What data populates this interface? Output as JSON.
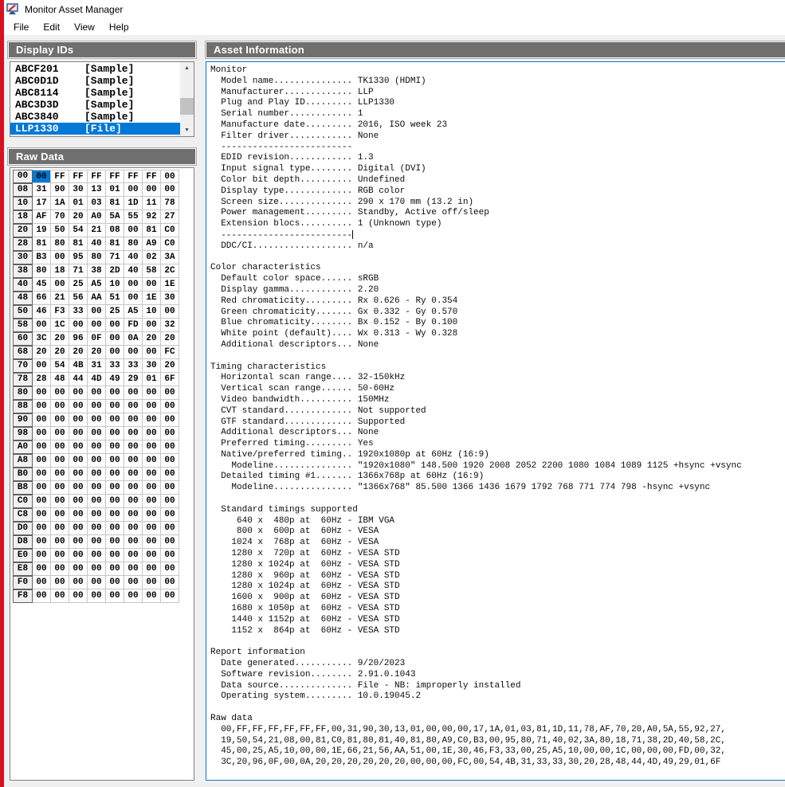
{
  "window": {
    "title": "Monitor Asset Manager",
    "menu_items": [
      "File",
      "Edit",
      "View",
      "Help"
    ]
  },
  "display_ids": {
    "header": "Display IDs",
    "items": [
      {
        "id": "ABCF201",
        "tag": "[Sample]",
        "selected": false
      },
      {
        "id": "ABC0D1D",
        "tag": "[Sample]",
        "selected": false
      },
      {
        "id": "ABC8114",
        "tag": "[Sample]",
        "selected": false
      },
      {
        "id": "ABC3D3D",
        "tag": "[Sample]",
        "selected": false
      },
      {
        "id": "ABC3840",
        "tag": "[Sample]",
        "selected": false
      },
      {
        "id": "LLP1330",
        "tag": "[File]",
        "selected": true
      }
    ],
    "scrollbar": {
      "up_icon": "▲",
      "down_icon": "▼"
    }
  },
  "raw_data": {
    "header": "Raw Data",
    "selected_cell": {
      "row": 0,
      "col": 0
    },
    "rows": [
      {
        "addr": "00",
        "bytes": [
          "00",
          "FF",
          "FF",
          "FF",
          "FF",
          "FF",
          "FF",
          "00"
        ]
      },
      {
        "addr": "08",
        "bytes": [
          "31",
          "90",
          "30",
          "13",
          "01",
          "00",
          "00",
          "00"
        ]
      },
      {
        "addr": "10",
        "bytes": [
          "17",
          "1A",
          "01",
          "03",
          "81",
          "1D",
          "11",
          "78"
        ]
      },
      {
        "addr": "18",
        "bytes": [
          "AF",
          "70",
          "20",
          "A0",
          "5A",
          "55",
          "92",
          "27"
        ]
      },
      {
        "addr": "20",
        "bytes": [
          "19",
          "50",
          "54",
          "21",
          "08",
          "00",
          "81",
          "C0"
        ]
      },
      {
        "addr": "28",
        "bytes": [
          "81",
          "80",
          "81",
          "40",
          "81",
          "80",
          "A9",
          "C0"
        ]
      },
      {
        "addr": "30",
        "bytes": [
          "B3",
          "00",
          "95",
          "80",
          "71",
          "40",
          "02",
          "3A"
        ]
      },
      {
        "addr": "38",
        "bytes": [
          "80",
          "18",
          "71",
          "38",
          "2D",
          "40",
          "58",
          "2C"
        ]
      },
      {
        "addr": "40",
        "bytes": [
          "45",
          "00",
          "25",
          "A5",
          "10",
          "00",
          "00",
          "1E"
        ]
      },
      {
        "addr": "48",
        "bytes": [
          "66",
          "21",
          "56",
          "AA",
          "51",
          "00",
          "1E",
          "30"
        ]
      },
      {
        "addr": "50",
        "bytes": [
          "46",
          "F3",
          "33",
          "00",
          "25",
          "A5",
          "10",
          "00"
        ]
      },
      {
        "addr": "58",
        "bytes": [
          "00",
          "1C",
          "00",
          "00",
          "00",
          "FD",
          "00",
          "32"
        ]
      },
      {
        "addr": "60",
        "bytes": [
          "3C",
          "20",
          "96",
          "0F",
          "00",
          "0A",
          "20",
          "20"
        ]
      },
      {
        "addr": "68",
        "bytes": [
          "20",
          "20",
          "20",
          "20",
          "00",
          "00",
          "00",
          "FC"
        ]
      },
      {
        "addr": "70",
        "bytes": [
          "00",
          "54",
          "4B",
          "31",
          "33",
          "33",
          "30",
          "20"
        ]
      },
      {
        "addr": "78",
        "bytes": [
          "28",
          "48",
          "44",
          "4D",
          "49",
          "29",
          "01",
          "6F"
        ]
      },
      {
        "addr": "80",
        "bytes": [
          "00",
          "00",
          "00",
          "00",
          "00",
          "00",
          "00",
          "00"
        ]
      },
      {
        "addr": "88",
        "bytes": [
          "00",
          "00",
          "00",
          "00",
          "00",
          "00",
          "00",
          "00"
        ]
      },
      {
        "addr": "90",
        "bytes": [
          "00",
          "00",
          "00",
          "00",
          "00",
          "00",
          "00",
          "00"
        ]
      },
      {
        "addr": "98",
        "bytes": [
          "00",
          "00",
          "00",
          "00",
          "00",
          "00",
          "00",
          "00"
        ]
      },
      {
        "addr": "A0",
        "bytes": [
          "00",
          "00",
          "00",
          "00",
          "00",
          "00",
          "00",
          "00"
        ]
      },
      {
        "addr": "A8",
        "bytes": [
          "00",
          "00",
          "00",
          "00",
          "00",
          "00",
          "00",
          "00"
        ]
      },
      {
        "addr": "B0",
        "bytes": [
          "00",
          "00",
          "00",
          "00",
          "00",
          "00",
          "00",
          "00"
        ]
      },
      {
        "addr": "B8",
        "bytes": [
          "00",
          "00",
          "00",
          "00",
          "00",
          "00",
          "00",
          "00"
        ]
      },
      {
        "addr": "C0",
        "bytes": [
          "00",
          "00",
          "00",
          "00",
          "00",
          "00",
          "00",
          "00"
        ]
      },
      {
        "addr": "C8",
        "bytes": [
          "00",
          "00",
          "00",
          "00",
          "00",
          "00",
          "00",
          "00"
        ]
      },
      {
        "addr": "D0",
        "bytes": [
          "00",
          "00",
          "00",
          "00",
          "00",
          "00",
          "00",
          "00"
        ]
      },
      {
        "addr": "D8",
        "bytes": [
          "00",
          "00",
          "00",
          "00",
          "00",
          "00",
          "00",
          "00"
        ]
      },
      {
        "addr": "E0",
        "bytes": [
          "00",
          "00",
          "00",
          "00",
          "00",
          "00",
          "00",
          "00"
        ]
      },
      {
        "addr": "E8",
        "bytes": [
          "00",
          "00",
          "00",
          "00",
          "00",
          "00",
          "00",
          "00"
        ]
      },
      {
        "addr": "F0",
        "bytes": [
          "00",
          "00",
          "00",
          "00",
          "00",
          "00",
          "00",
          "00"
        ]
      },
      {
        "addr": "F8",
        "bytes": [
          "00",
          "00",
          "00",
          "00",
          "00",
          "00",
          "00",
          "00"
        ]
      }
    ]
  },
  "asset_info": {
    "header": "Asset Information",
    "caret_line_index": 15,
    "lines": [
      "Monitor",
      "  Model name............... TK1330 (HDMI)",
      "  Manufacturer............. LLP",
      "  Plug and Play ID......... LLP1330",
      "  Serial number............ 1",
      "  Manufacture date......... 2016, ISO week 23",
      "  Filter driver............ None",
      "  -------------------------",
      "  EDID revision............ 1.3",
      "  Input signal type........ Digital (DVI)",
      "  Color bit depth.......... Undefined",
      "  Display type............. RGB color",
      "  Screen size.............. 290 x 170 mm (13.2 in)",
      "  Power management......... Standby, Active off/sleep",
      "  Extension blocs.......... 1 (Unknown type)",
      "  -------------------------",
      "  DDC/CI................... n/a",
      "",
      "Color characteristics",
      "  Default color space...... sRGB",
      "  Display gamma............ 2.20",
      "  Red chromaticity......... Rx 0.626 - Ry 0.354",
      "  Green chromaticity....... Gx 0.332 - Gy 0.570",
      "  Blue chromaticity........ Bx 0.152 - By 0.100",
      "  White point (default).... Wx 0.313 - Wy 0.328",
      "  Additional descriptors... None",
      "",
      "Timing characteristics",
      "  Horizontal scan range.... 32-150kHz",
      "  Vertical scan range...... 50-60Hz",
      "  Video bandwidth.......... 150MHz",
      "  CVT standard............. Not supported",
      "  GTF standard............. Supported",
      "  Additional descriptors... None",
      "  Preferred timing......... Yes",
      "  Native/preferred timing.. 1920x1080p at 60Hz (16:9)",
      "    Modeline............... \"1920x1080\" 148.500 1920 2008 2052 2200 1080 1084 1089 1125 +hsync +vsync",
      "  Detailed timing #1....... 1366x768p at 60Hz (16:9)",
      "    Modeline............... \"1366x768\" 85.500 1366 1436 1679 1792 768 771 774 798 -hsync +vsync",
      "",
      "  Standard timings supported",
      "     640 x  480p at  60Hz - IBM VGA",
      "     800 x  600p at  60Hz - VESA",
      "    1024 x  768p at  60Hz - VESA",
      "    1280 x  720p at  60Hz - VESA STD",
      "    1280 x 1024p at  60Hz - VESA STD",
      "    1280 x  960p at  60Hz - VESA STD",
      "    1280 x 1024p at  60Hz - VESA STD",
      "    1600 x  900p at  60Hz - VESA STD",
      "    1680 x 1050p at  60Hz - VESA STD",
      "    1440 x 1152p at  60Hz - VESA STD",
      "    1152 x  864p at  60Hz - VESA STD",
      "",
      "Report information",
      "  Date generated........... 9/20/2023",
      "  Software revision........ 2.91.0.1043",
      "  Data source.............. File - NB: improperly installed",
      "  Operating system......... 10.0.19045.2",
      "",
      "Raw data",
      "  00,FF,FF,FF,FF,FF,FF,00,31,90,30,13,01,00,00,00,17,1A,01,03,81,1D,11,78,AF,70,20,A0,5A,55,92,27,",
      "  19,50,54,21,08,00,81,C0,81,80,81,40,81,80,A9,C0,B3,00,95,80,71,40,02,3A,80,18,71,38,2D,40,58,2C,",
      "  45,00,25,A5,10,00,00,1E,66,21,56,AA,51,00,1E,30,46,F3,33,00,25,A5,10,00,00,1C,00,00,00,FD,00,32,",
      "  3C,20,96,0F,00,0A,20,20,20,20,20,20,00,00,00,FC,00,54,4B,31,33,33,30,20,28,48,44,4D,49,29,01,6F"
    ]
  },
  "colors": {
    "selection_blue": "#0078d7",
    "window_border_red": "#d8101f",
    "panel_header_gray": "#6f6f6f"
  }
}
